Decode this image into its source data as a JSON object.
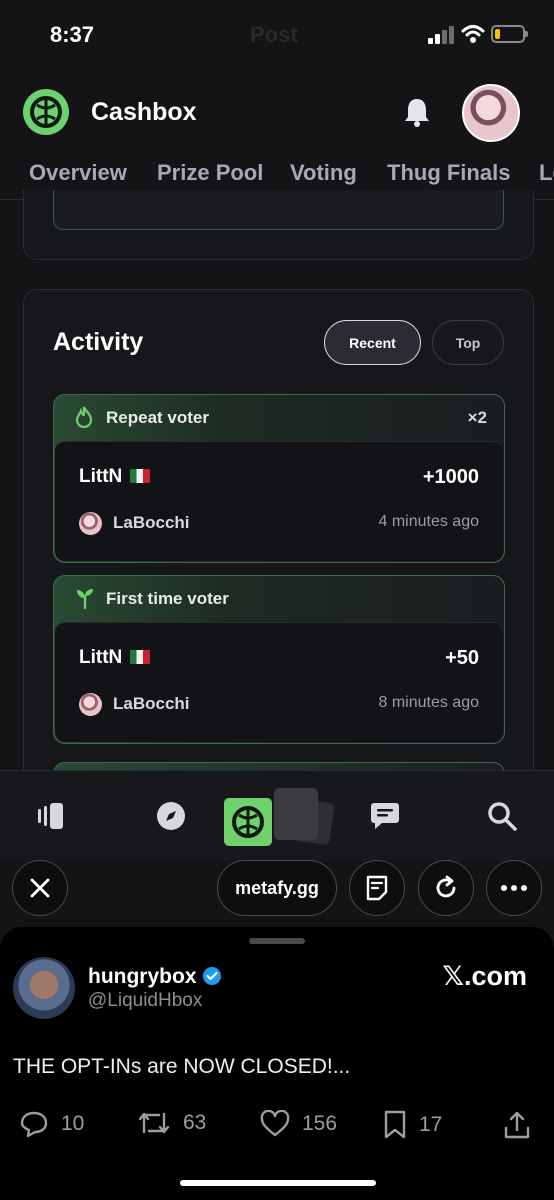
{
  "status": {
    "time": "8:37",
    "ghost_title": "Post"
  },
  "header": {
    "title": "Cashbox"
  },
  "tabs": [
    "Overview",
    "Prize Pool",
    "Voting",
    "Thug Finals",
    "Le"
  ],
  "activity": {
    "title": "Activity",
    "filters": {
      "recent": "Recent",
      "top": "Top",
      "selected": "Recent"
    },
    "items": [
      {
        "type": "Repeat voter",
        "multiplier": "×2",
        "name": "LittN",
        "points": "+1000",
        "user": "LaBocchi",
        "time": "4 minutes ago"
      },
      {
        "type": "First time voter",
        "multiplier": "",
        "name": "LittN",
        "points": "+50",
        "user": "LaBocchi",
        "time": "8 minutes ago"
      }
    ]
  },
  "nav": {
    "icons": [
      "library-icon",
      "explore-icon",
      "tabs-icon",
      "chat-icon",
      "search-icon"
    ]
  },
  "browser": {
    "url": "metafy.gg"
  },
  "post": {
    "display_name": "hungrybox",
    "handle": "@LiquidHbox",
    "brand": "𝕏.com",
    "text": "THE OPT-INs are NOW CLOSED!...",
    "replies": "10",
    "reposts": "63",
    "likes": "156",
    "bookmarks": "17"
  },
  "colors": {
    "accent": "#6fd16e",
    "background": "#141416",
    "card_border": "#3f6b4a"
  }
}
